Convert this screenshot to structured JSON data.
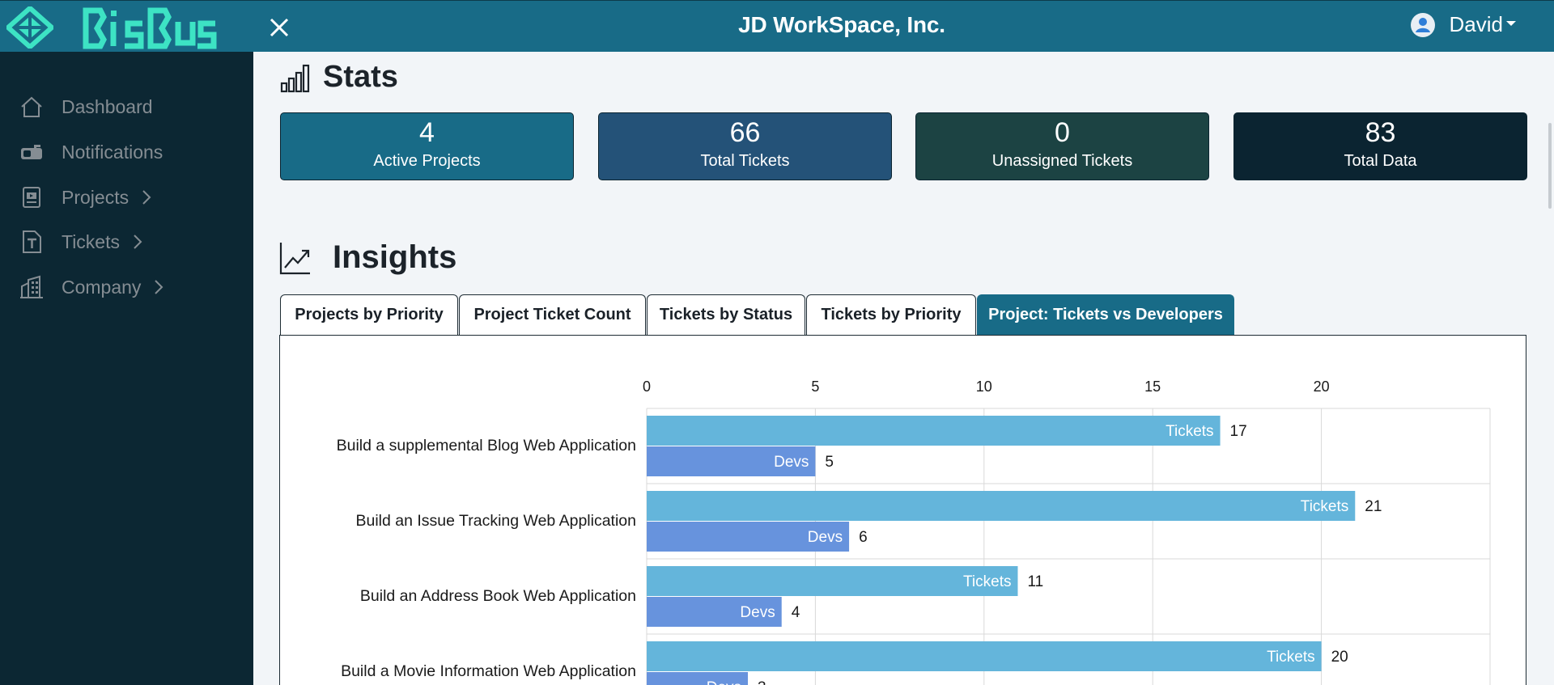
{
  "header": {
    "logo_text": "BigBug",
    "title": "JD WorkSpace, Inc.",
    "user_name": "David"
  },
  "sidebar": {
    "items": [
      {
        "label": "Dashboard",
        "icon": "home-icon"
      },
      {
        "label": "Notifications",
        "icon": "mailbox-icon"
      },
      {
        "label": "Projects",
        "icon": "presentation-icon",
        "chevron": true
      },
      {
        "label": "Tickets",
        "icon": "ticket-file-icon",
        "chevron": true
      },
      {
        "label": "Company",
        "icon": "buildings-icon",
        "chevron": true
      }
    ]
  },
  "stats": {
    "title": "Stats",
    "cards": [
      {
        "value": "4",
        "label": "Active Projects",
        "color": "#186b87"
      },
      {
        "value": "66",
        "label": "Total Tickets",
        "color": "#245278"
      },
      {
        "value": "0",
        "label": "Unassigned Tickets",
        "color": "#1c4343"
      },
      {
        "value": "83",
        "label": "Total Data",
        "color": "#0b2431"
      }
    ]
  },
  "insights": {
    "title": "Insights",
    "tabs": [
      {
        "label": "Projects by Priority",
        "active": false
      },
      {
        "label": "Project Ticket Count",
        "active": false
      },
      {
        "label": "Tickets by Status",
        "active": false
      },
      {
        "label": "Tickets by Priority",
        "active": false
      },
      {
        "label": "Project: Tickets vs Developers",
        "active": true
      }
    ]
  },
  "chart_data": {
    "type": "bar",
    "orientation": "horizontal",
    "categories": [
      "Build a supplemental Blog Web Application",
      "Build an Issue Tracking Web Application",
      "Build an Address Book Web Application",
      "Build a Movie Information Web Application"
    ],
    "series": [
      {
        "name": "Tickets",
        "values": [
          17,
          21,
          11,
          20
        ],
        "color": "#64b5db"
      },
      {
        "name": "Devs",
        "values": [
          5,
          6,
          4,
          3
        ],
        "color": "#6793dd"
      }
    ],
    "x_ticks": [
      0,
      5,
      10,
      15,
      20
    ],
    "xlim": [
      0,
      25
    ],
    "x_axis_position": "top",
    "grid": true
  },
  "colors": {
    "header": "#186b87",
    "sidebar": "#0c2733",
    "accent": "#3de3c4"
  }
}
